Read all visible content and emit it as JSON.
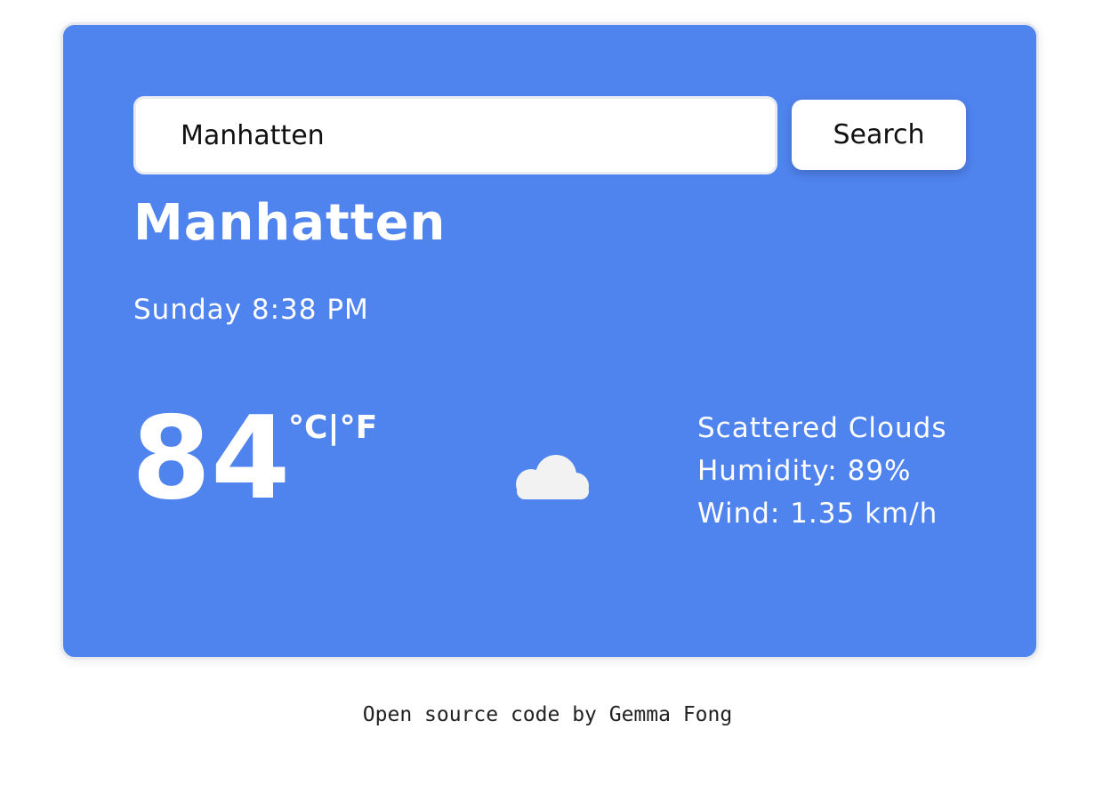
{
  "search": {
    "value": "Manhatten",
    "button_label": "Search"
  },
  "weather": {
    "city": "Manhatten",
    "datetime": "Sunday 8:38 PM",
    "temperature": "84",
    "unit_celsius": "°C",
    "unit_separator": "|",
    "unit_fahrenheit": "°F",
    "icon": "cloud-icon",
    "description": "Scattered Clouds",
    "humidity": "Humidity: 89%",
    "wind": "Wind: 1.35 km/h"
  },
  "footer": {
    "link_text": "Open source code",
    "by_text": " by Gemma Fong"
  },
  "colors": {
    "card_background": "#4f83ee",
    "text_on_card": "#ffffff",
    "cloud": "#f2f2f2"
  }
}
